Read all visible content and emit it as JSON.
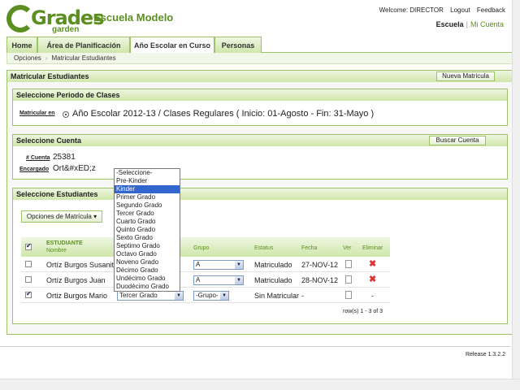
{
  "brand": {
    "logo_top": "Grades",
    "logo_bottom": "garden",
    "school": "Escuela Modelo",
    "accent": "#5b8f22"
  },
  "header": {
    "welcome": "Welcome: DIRECTOR",
    "logout": "Logout",
    "feedback": "Feedback",
    "escuela": "Escuela",
    "mi_cuenta": "Mi Cuenta"
  },
  "nav": {
    "tabs": [
      "Home",
      "Área de Planificación",
      "Año Escolar en Curso",
      "Personas"
    ],
    "active": "Año Escolar en Curso"
  },
  "breadcrumb": {
    "items": [
      "Opciones",
      "Matricular Estudiantes"
    ]
  },
  "panel": {
    "title": "Matricular Estudiantes",
    "new_button": "Nueva Matricula"
  },
  "periodo": {
    "title": "Seleccione Periodo de Clases",
    "label": "Matricular en",
    "value": "Año Escolar 2012-13 / Clases Regulares ( Inicio: 01-Agosto - Fin: 31-Mayo )"
  },
  "cuenta": {
    "title": "Seleccione Cuenta",
    "search_button": "Buscar Cuenta",
    "num_label": "# Cuenta",
    "num_value": "25381",
    "enc_label": "Encargado",
    "enc_value": "Ort&#xED;z"
  },
  "estudiantes": {
    "title": "Seleccione Estudiantes",
    "options_button": "Opciones de Matrícula",
    "columns": {
      "estudiante": "ESTUDIANTE",
      "nombre": "Nombre",
      "grupo": "Grupo",
      "estatus": "Estatus",
      "fecha": "Fecha",
      "ver": "Ver",
      "eliminar": "Eliminar"
    },
    "rows": [
      {
        "nombre": "Ortíz Burgos Susanita",
        "grado": "",
        "grupo": "A",
        "estatus": "Matriculado",
        "fecha": "27-NOV-12",
        "checked": false
      },
      {
        "nombre": "Ortíz Burgos Juan",
        "grado": "",
        "grupo": "A",
        "estatus": "Matriculado",
        "fecha": "28-NOV-12",
        "checked": false
      },
      {
        "nombre": "Ortiz Burgos Mario",
        "grado": "Tercer Grado",
        "grupo": "-Grupo-",
        "estatus": "Sin Matricular",
        "fecha": "-",
        "checked": true
      }
    ],
    "dash": "-",
    "pager": "row(s) 1 - 3 of 3"
  },
  "grade_dropdown": {
    "options": [
      "-Seleccione-",
      "Pre-Kinder",
      "Kinder",
      "Primer Grado",
      "Segundo Grado",
      "Tercer Grado",
      "Cuarto Grado",
      "Quinto Grado",
      "Sexto Grado",
      "Septimo Grado",
      "Octavo Grado",
      "Noveno Grado",
      "Décimo Grado",
      "Undécimo Grado",
      "Duodécimo Grado"
    ],
    "highlighted": "Kinder"
  },
  "footer": {
    "release": "Release 1.3.2.2"
  }
}
